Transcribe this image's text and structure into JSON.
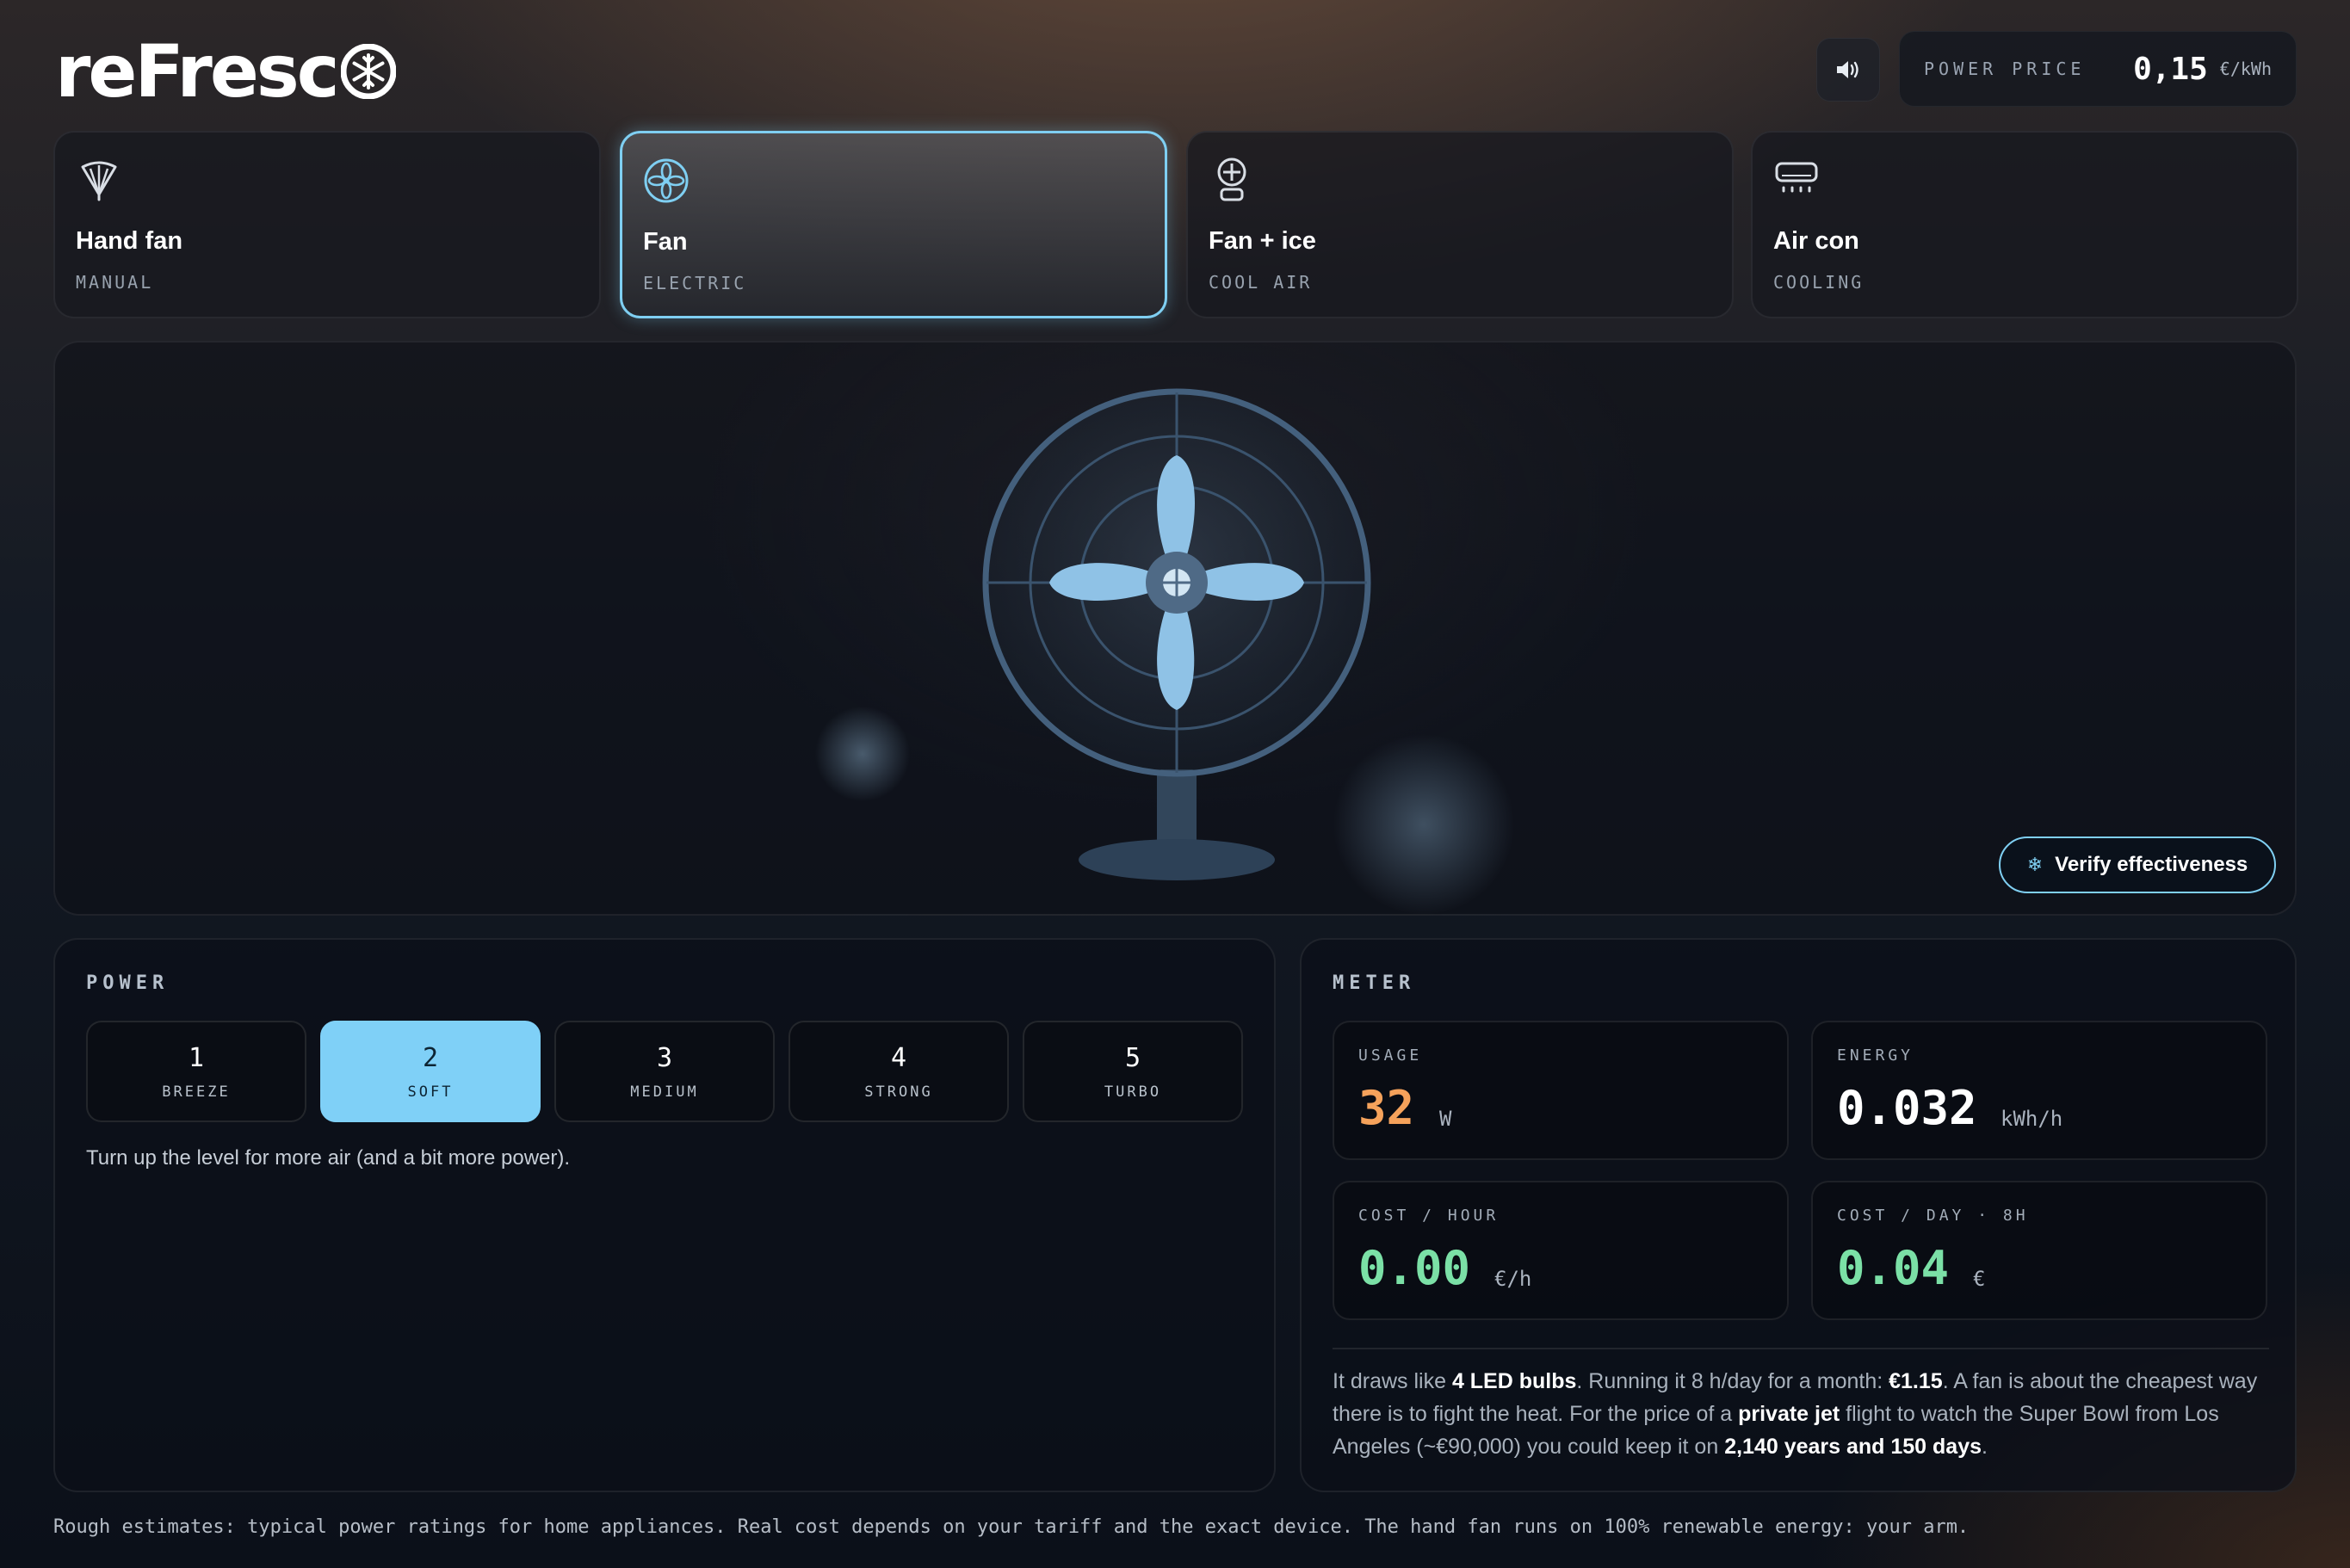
{
  "brand": {
    "name": "reFresc",
    "logo_icon": "snowflake-icon"
  },
  "header": {
    "sound_icon": "speaker-icon",
    "price_label": "POWER PRICE",
    "price_value": "0,15",
    "price_unit": "€/kWh"
  },
  "modes": [
    {
      "name": "Hand fan",
      "sub": "MANUAL",
      "icon": "hand-fan-icon"
    },
    {
      "name": "Fan",
      "sub": "ELECTRIC",
      "icon": "fan-icon"
    },
    {
      "name": "Fan + ice",
      "sub": "COOL AIR",
      "icon": "fan-ice-icon"
    },
    {
      "name": "Air con",
      "sub": "COOLING",
      "icon": "air-con-icon"
    }
  ],
  "selected_mode": "Fan",
  "stage": {
    "verify_label": "Verify effectiveness",
    "verify_icon": "snowflake-icon"
  },
  "power": {
    "title": "POWER",
    "levels": [
      {
        "num": "1",
        "label": "BREEZE"
      },
      {
        "num": "2",
        "label": "SOFT"
      },
      {
        "num": "3",
        "label": "MEDIUM"
      },
      {
        "num": "4",
        "label": "STRONG"
      },
      {
        "num": "5",
        "label": "TURBO"
      }
    ],
    "selected_level": "2",
    "hint": "Turn up the level for more air (and a bit more power)."
  },
  "meter": {
    "title": "METER",
    "usage": {
      "label": "USAGE",
      "value": "32",
      "unit": "W"
    },
    "energy": {
      "label": "ENERGY",
      "value": "0.032",
      "unit": "kWh/h"
    },
    "cost_hour": {
      "label": "COST / HOUR",
      "value": "0.00",
      "unit": "€/h"
    },
    "cost_day": {
      "label": "COST / DAY · 8H",
      "value": "0.04",
      "unit": "€"
    },
    "sentence": {
      "s1": "It draws like ",
      "b1": "4 LED bulbs",
      "s2": ". Running it 8 h/day for a month: ",
      "b2": "€1.15",
      "s3": ". A fan is about the cheapest way there is to fight the heat. For the price of a ",
      "b3": "private jet",
      "s4": " flight to watch the Super Bowl from Los Angeles (~€90,000) you could keep it on ",
      "b4": "2,140 years and 150 days",
      "s5": "."
    }
  },
  "footer": "Rough estimates: typical power ratings for home appliances. Real cost depends on your tariff and the exact device. The hand fan runs on 100% renewable energy: your arm.",
  "colors": {
    "accent": "#7fd0f7",
    "usage": "#f5a25b",
    "cost": "#7be0a6",
    "fan_blade": "#8fc2e6",
    "fan_frame": "#3f5872"
  }
}
